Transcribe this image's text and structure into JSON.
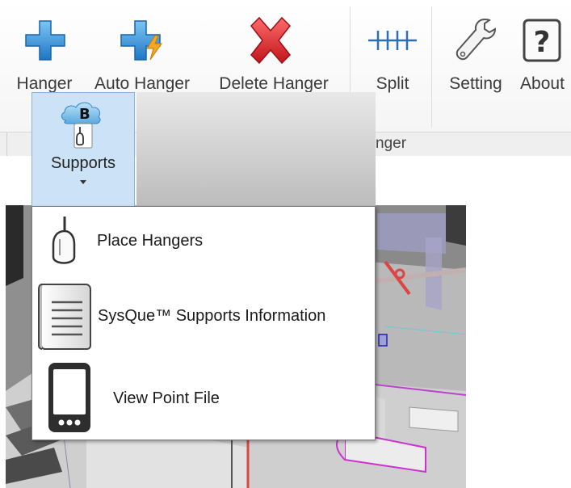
{
  "ribbon": {
    "buttons": [
      {
        "label": "Hanger",
        "icon": "blue-plus-icon"
      },
      {
        "label": "Auto Hanger",
        "icon": "blue-plus-lightning-icon"
      },
      {
        "label": "Delete Hanger",
        "icon": "red-x-icon"
      },
      {
        "label": "Split",
        "icon": "split-icon"
      },
      {
        "label": "Setting",
        "icon": "wrench-icon"
      },
      {
        "label": "About",
        "icon": "question-icon"
      }
    ],
    "panel_title": "nger"
  },
  "supports": {
    "label": "Supports",
    "icon": "bim-hanger-icon",
    "icon_text": "B"
  },
  "menu": {
    "items": [
      {
        "label": "Place Hangers",
        "icon": "hanger-icon"
      },
      {
        "label": "SysQue™ Supports Information",
        "icon": "document-icon"
      },
      {
        "label": "View Point File",
        "icon": "tablet-icon"
      }
    ]
  },
  "colors": {
    "accent_blue": "#2f8fd6",
    "delete_red": "#d9262b",
    "tab_highlight": "#cce3f7"
  }
}
